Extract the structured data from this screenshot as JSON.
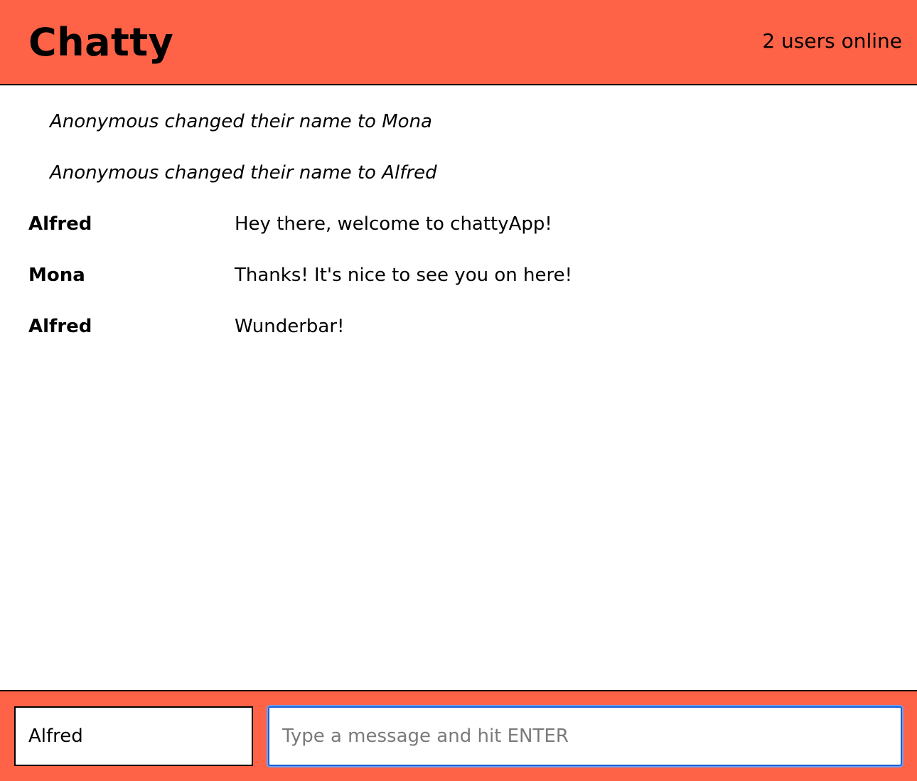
{
  "navbar": {
    "brand": "Chatty",
    "users_online": "2 users online"
  },
  "messages": [
    {
      "type": "notification",
      "content": "Anonymous changed their name to Mona"
    },
    {
      "type": "notification",
      "content": "Anonymous changed their name to Alfred"
    },
    {
      "type": "message",
      "username": "Alfred",
      "content": "Hey there, welcome to chattyApp!"
    },
    {
      "type": "message",
      "username": "Mona",
      "content": "Thanks! It's nice to see you on here!"
    },
    {
      "type": "message",
      "username": "Alfred",
      "content": "Wunderbar!"
    }
  ],
  "chatbar": {
    "username_value": "Alfred",
    "message_placeholder": "Type a message and hit ENTER",
    "message_value": ""
  },
  "colors": {
    "accent": "#ff6347",
    "focus_ring": "#1a5fd6"
  }
}
